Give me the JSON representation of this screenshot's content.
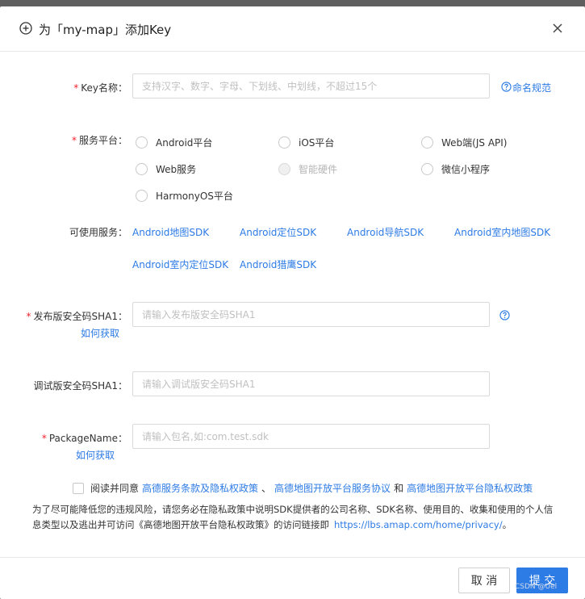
{
  "dialog": {
    "title": "为「my-map」添加Key",
    "icons": {
      "title": "circle-plus-icon",
      "close": "close-icon"
    }
  },
  "form": {
    "key_name": {
      "required": "*",
      "label": "Key名称：",
      "placeholder": "支持汉字、数字、字母、下划线、中划线，不超过15个",
      "help_link": "命名规范",
      "help_icon": "question-circle-icon"
    },
    "platform": {
      "required": "*",
      "label": "服务平台：",
      "options": [
        {
          "label": "Android平台",
          "disabled": false
        },
        {
          "label": "iOS平台",
          "disabled": false
        },
        {
          "label": "Web端(JS API)",
          "disabled": false
        },
        {
          "label": "Web服务",
          "disabled": false
        },
        {
          "label": "智能硬件",
          "disabled": true
        },
        {
          "label": "微信小程序",
          "disabled": false
        },
        {
          "label": "HarmonyOS平台",
          "disabled": false
        }
      ]
    },
    "services": {
      "label": "可使用服务：",
      "items": [
        "Android地图SDK",
        "Android定位SDK",
        "Android导航SDK",
        "Android室内地图SDK",
        "Android室内定位SDK",
        "Android猎鹰SDK"
      ]
    },
    "release_sha1": {
      "required": "*",
      "label": "发布版安全码SHA1：",
      "how_link": "如何获取",
      "placeholder": "请输入发布版安全码SHA1",
      "help_icon": "question-circle-icon"
    },
    "debug_sha1": {
      "label": "调试版安全码SHA1：",
      "placeholder": "请输入调试版安全码SHA1"
    },
    "package_name": {
      "required": "*",
      "label": "PackageName：",
      "how_link": "如何获取",
      "placeholder": "请输入包名,如:com.test.sdk"
    }
  },
  "agreement": {
    "prefix": "阅读并同意",
    "link1": "高德服务条款及隐私权政策",
    "sep1": "、",
    "link2": "高德地图开放平台服务协议",
    "sep2": "和",
    "link3": "高德地图开放平台隐私权政策"
  },
  "notice": {
    "text": "为了尽可能降低您的违规风险，请您务必在隐私政策中说明SDK提供者的公司名称、SDK名称、使用目的、收集和使用的个人信息类型以及逃出并可访问《高德地图开放平台隐私权政策》的访问链接即",
    "link": "https://lbs.amap.com/home/privacy/",
    "end": "。"
  },
  "footer": {
    "cancel": "取 消",
    "submit": "提 交"
  },
  "watermark": "CSDN @Uel",
  "colors": {
    "accent": "#2d7be5",
    "required": "#f5222d",
    "overlay": "#5f5f5f"
  }
}
